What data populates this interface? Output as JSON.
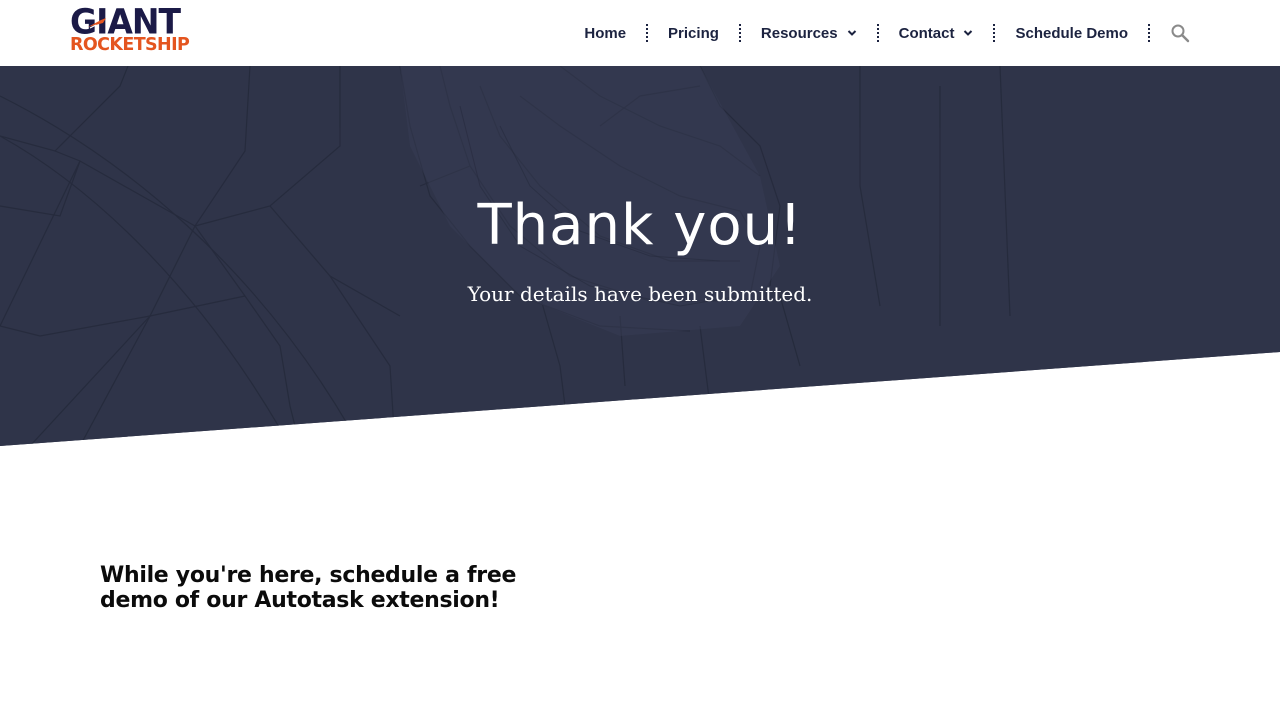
{
  "brand": {
    "logo_line1": "GIANT",
    "logo_line2": "ROCKETSHIP",
    "primary_color": "#1b1a47",
    "accent_color": "#e4551f"
  },
  "nav": {
    "items": [
      {
        "label": "Home",
        "has_dropdown": false
      },
      {
        "label": "Pricing",
        "has_dropdown": false
      },
      {
        "label": "Resources",
        "has_dropdown": true
      },
      {
        "label": "Contact",
        "has_dropdown": true
      },
      {
        "label": "Schedule Demo",
        "has_dropdown": false
      }
    ],
    "search_icon": "search-icon",
    "dropdown_icon": "chevron-down-icon"
  },
  "hero": {
    "title": "Thank you!",
    "subtitle": "Your details have been submitted.",
    "background_color": "#2f3449"
  },
  "section": {
    "heading": "While you're here, schedule a free demo of our Autotask extension!"
  }
}
